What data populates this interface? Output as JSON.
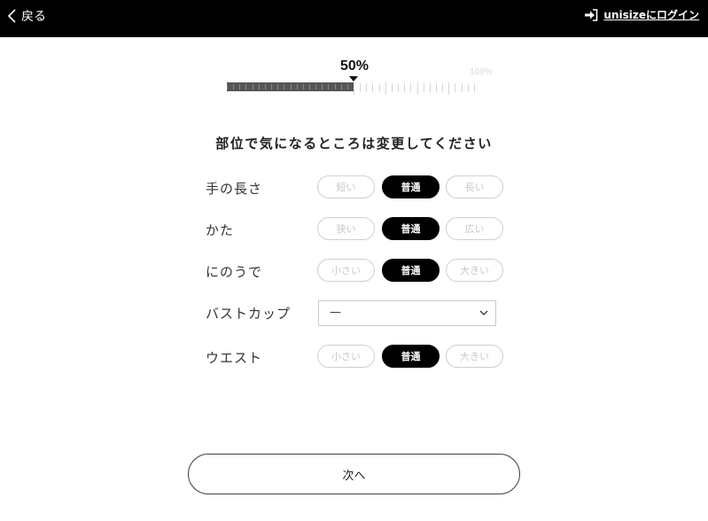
{
  "header": {
    "back_label": "戻る",
    "login_label": "unisizeにログイン"
  },
  "progress": {
    "percent": 50,
    "percent_label": "50%",
    "max_label": "100%"
  },
  "heading": "部位で気になるところは変更してください",
  "rows": [
    {
      "label": "手の長さ",
      "options": [
        "短い",
        "普通",
        "長い"
      ],
      "selected": 1
    },
    {
      "label": "かた",
      "options": [
        "狭い",
        "普通",
        "広い"
      ],
      "selected": 1
    },
    {
      "label": "にのうで",
      "options": [
        "小さい",
        "普通",
        "大きい"
      ],
      "selected": 1
    },
    {
      "label": "ウエスト",
      "options": [
        "小さい",
        "普通",
        "大きい"
      ],
      "selected": 1
    }
  ],
  "bust": {
    "label": "バストカップ",
    "value": "—"
  },
  "next_label": "次へ",
  "colors": {
    "accent": "#000000",
    "bar_fill": "#555555",
    "inactive_text": "#c8c8c8"
  }
}
